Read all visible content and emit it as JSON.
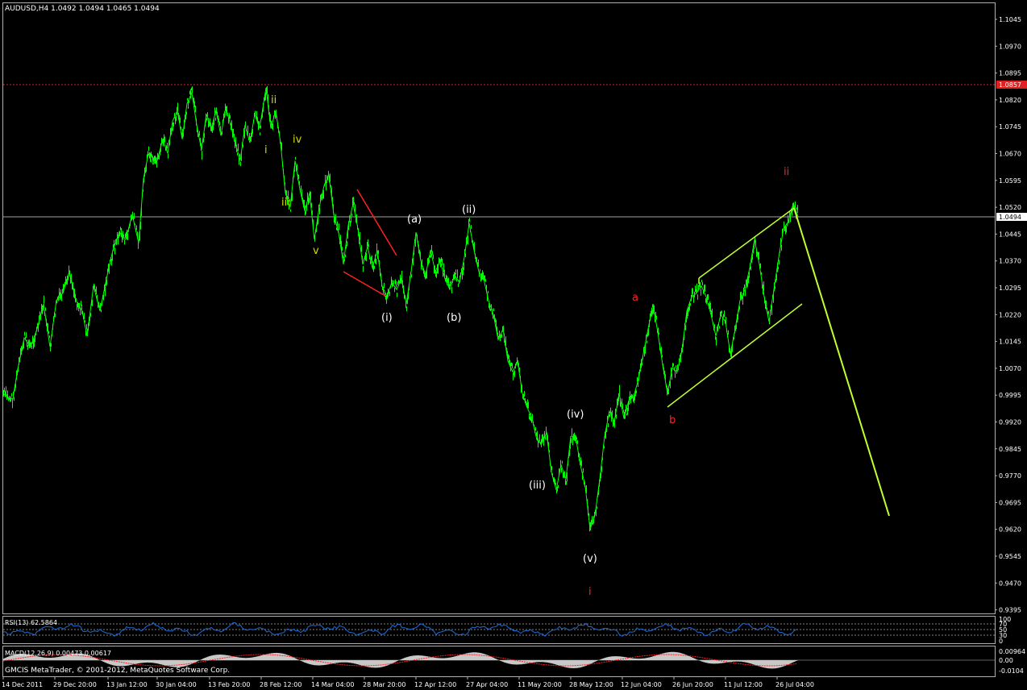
{
  "window": {
    "symbol_line": "AUDUSD,H4  1.0492 1.0494 1.0465 1.0494",
    "copyright": "GMCIS MetaTrader, © 2001-2012, MetaQuotes Software Corp."
  },
  "colors": {
    "background": "#000000",
    "price": "#00ff00",
    "channel": "#c0ff30",
    "red_line": "#ff2020",
    "frame": "#b0b0b0",
    "resistance_dash": "#d03020",
    "rsi_line": "#1e6cd8",
    "macd_hist": "#c8c8c8",
    "macd_signal": "#ff2020",
    "wave_white": "#ffffff",
    "wave_yellow": "#d8d800",
    "wave_red": "#ff2020"
  },
  "price_axis": {
    "ticks": [
      "1.1045",
      "1.0970",
      "1.0895",
      "1.0820",
      "1.0745",
      "1.0670",
      "1.0595",
      "1.0520",
      "1.0445",
      "1.0370",
      "1.0295",
      "1.0220",
      "1.0145",
      "1.0070",
      "0.9995",
      "0.9920",
      "0.9845",
      "0.9770",
      "0.9695",
      "0.9620",
      "0.9545",
      "0.9470",
      "0.9395"
    ],
    "resistance_label": "1.0857",
    "current_label": "1.0494"
  },
  "time_axis": {
    "labels": [
      "14 Dec 2011",
      "29 Dec 20:00",
      "13 Jan 12:00",
      "30 Jan 04:00",
      "13 Feb 20:00",
      "28 Feb 12:00",
      "14 Mar 04:00",
      "28 Mar 20:00",
      "12 Apr 12:00",
      "27 Apr 04:00",
      "11 May 20:00",
      "28 May 12:00",
      "12 Jun 04:00",
      "26 Jun 20:00",
      "11 Jul 12:00",
      "26 Jul 04:00"
    ]
  },
  "rsi": {
    "label": "RSI(13) 62.5864",
    "levels": [
      "100",
      "70",
      "50",
      "30",
      "0"
    ]
  },
  "macd": {
    "label": "MACD(12,26,9) 0.00473 0.00617",
    "levels": [
      "0.00964",
      "0.00",
      "-0.0104"
    ]
  },
  "wave_labels": {
    "minor_yellow": [
      "ii",
      "i",
      "iv",
      "iii",
      "v"
    ],
    "minute_white": [
      "(a)",
      "(ii)",
      "(i)",
      "(b)",
      "(iv)",
      "(iii)",
      "(v)"
    ],
    "major_red": [
      "a",
      "b",
      "ii",
      "i"
    ]
  },
  "price_path": [
    [
      4,
      1.0
    ],
    [
      10,
      0.9988
    ],
    [
      16,
      0.9985
    ],
    [
      22,
      1.0068
    ],
    [
      30,
      1.0155
    ],
    [
      38,
      1.013
    ],
    [
      46,
      1.018
    ],
    [
      54,
      1.025
    ],
    [
      62,
      1.013
    ],
    [
      70,
      1.026
    ],
    [
      78,
      1.028
    ],
    [
      86,
      1.034
    ],
    [
      94,
      1.026
    ],
    [
      102,
      1.023
    ],
    [
      108,
      1.016
    ],
    [
      116,
      1.03
    ],
    [
      124,
      1.023
    ],
    [
      132,
      1.032
    ],
    [
      140,
      1.04
    ],
    [
      148,
      1.045
    ],
    [
      156,
      1.043
    ],
    [
      164,
      1.05
    ],
    [
      172,
      1.042
    ],
    [
      178,
      1.06
    ],
    [
      184,
      1.067
    ],
    [
      190,
      1.064
    ],
    [
      196,
      1.066
    ],
    [
      202,
      1.071
    ],
    [
      208,
      1.067
    ],
    [
      214,
      1.076
    ],
    [
      220,
      1.079
    ],
    [
      226,
      1.071
    ],
    [
      232,
      1.081
    ],
    [
      238,
      1.084
    ],
    [
      244,
      1.075
    ],
    [
      250,
      1.068
    ],
    [
      256,
      1.078
    ],
    [
      262,
      1.074
    ],
    [
      268,
      1.079
    ],
    [
      274,
      1.072
    ],
    [
      280,
      1.08
    ],
    [
      286,
      1.075
    ],
    [
      292,
      1.07
    ],
    [
      298,
      1.065
    ],
    [
      304,
      1.075
    ],
    [
      310,
      1.07
    ],
    [
      316,
      1.078
    ],
    [
      322,
      1.074
    ],
    [
      330,
      1.0854
    ],
    [
      336,
      1.074
    ],
    [
      342,
      1.079
    ],
    [
      348,
      1.07
    ],
    [
      354,
      1.056
    ],
    [
      360,
      1.052
    ],
    [
      366,
      1.065
    ],
    [
      372,
      1.057
    ],
    [
      378,
      1.051
    ],
    [
      384,
      1.056
    ],
    [
      390,
      1.043
    ],
    [
      396,
      1.052
    ],
    [
      402,
      1.058
    ],
    [
      408,
      1.061
    ],
    [
      414,
      1.05
    ],
    [
      420,
      1.045
    ],
    [
      426,
      1.036
    ],
    [
      432,
      1.047
    ],
    [
      438,
      1.053
    ],
    [
      444,
      1.046
    ],
    [
      450,
      1.036
    ],
    [
      456,
      1.041
    ],
    [
      462,
      1.035
    ],
    [
      468,
      1.04
    ],
    [
      474,
      1.03
    ],
    [
      480,
      1.027
    ],
    [
      486,
      1.031
    ],
    [
      492,
      1.029
    ],
    [
      498,
      1.032
    ],
    [
      504,
      1.025
    ],
    [
      510,
      1.034
    ],
    [
      516,
      1.045
    ],
    [
      522,
      1.037
    ],
    [
      528,
      1.033
    ],
    [
      534,
      1.04
    ],
    [
      540,
      1.034
    ],
    [
      546,
      1.037
    ],
    [
      552,
      1.032
    ],
    [
      558,
      1.029
    ],
    [
      564,
      1.033
    ],
    [
      570,
      1.031
    ],
    [
      576,
      1.038
    ],
    [
      582,
      1.0475
    ],
    [
      588,
      1.04
    ],
    [
      594,
      1.034
    ],
    [
      600,
      1.032
    ],
    [
      606,
      1.026
    ],
    [
      612,
      1.022
    ],
    [
      618,
      1.015
    ],
    [
      624,
      1.018
    ],
    [
      630,
      1.009
    ],
    [
      636,
      1.006
    ],
    [
      642,
      1.009
    ],
    [
      648,
      1.0
    ],
    [
      654,
      0.996
    ],
    [
      660,
      0.993
    ],
    [
      666,
      0.987
    ],
    [
      672,
      0.986
    ],
    [
      678,
      0.989
    ],
    [
      684,
      0.978
    ],
    [
      690,
      0.973
    ],
    [
      696,
      0.98
    ],
    [
      702,
      0.976
    ],
    [
      708,
      0.988
    ],
    [
      714,
      0.988
    ],
    [
      720,
      0.98
    ],
    [
      726,
      0.974
    ],
    [
      732,
      0.962
    ],
    [
      738,
      0.966
    ],
    [
      744,
      0.976
    ],
    [
      750,
      0.988
    ],
    [
      756,
      0.995
    ],
    [
      762,
      0.992
    ],
    [
      768,
      1.0
    ],
    [
      774,
      0.993
    ],
    [
      780,
      0.998
    ],
    [
      786,
      0.999
    ],
    [
      792,
      1.004
    ],
    [
      798,
      1.011
    ],
    [
      804,
      1.018
    ],
    [
      810,
      1.025
    ],
    [
      816,
      1.017
    ],
    [
      822,
      1.008
    ],
    [
      828,
      1.0
    ],
    [
      834,
      1.007
    ],
    [
      840,
      1.006
    ],
    [
      846,
      1.012
    ],
    [
      852,
      1.023
    ],
    [
      858,
      1.027
    ],
    [
      864,
      1.028
    ],
    [
      870,
      1.03
    ],
    [
      876,
      1.027
    ],
    [
      882,
      1.022
    ],
    [
      888,
      1.016
    ],
    [
      894,
      1.022
    ],
    [
      900,
      1.02
    ],
    [
      906,
      1.011
    ],
    [
      912,
      1.018
    ],
    [
      918,
      1.026
    ],
    [
      924,
      1.029
    ],
    [
      930,
      1.035
    ],
    [
      936,
      1.043
    ],
    [
      942,
      1.036
    ],
    [
      948,
      1.027
    ],
    [
      954,
      1.02
    ],
    [
      960,
      1.029
    ],
    [
      966,
      1.038
    ],
    [
      972,
      1.046
    ],
    [
      978,
      1.048
    ],
    [
      984,
      1.053
    ],
    [
      990,
      1.0494
    ]
  ]
}
